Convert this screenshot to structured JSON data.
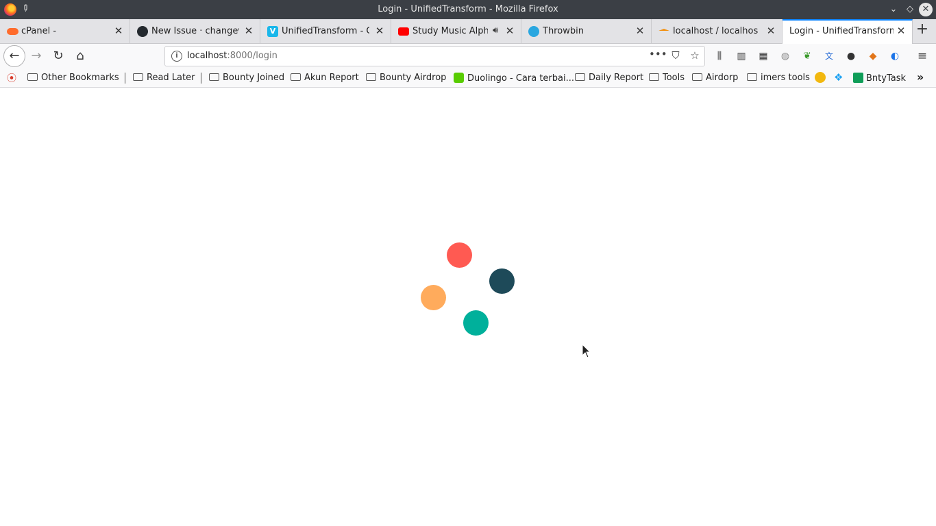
{
  "window": {
    "title": "Login - UnifiedTransform - Mozilla Firefox"
  },
  "tabs": [
    {
      "label": "cPanel -",
      "icon": "cpanel-icon",
      "color": "#ff6c2c"
    },
    {
      "label": "New Issue · changew",
      "icon": "github-icon",
      "color": "#24292e"
    },
    {
      "label": "UnifiedTransform - G",
      "icon": "vimeo-icon",
      "color": "#1ab7ea"
    },
    {
      "label": "Study Music Alpha",
      "icon": "youtube-icon",
      "color": "#ff0000"
    },
    {
      "label": "Throwbin",
      "icon": "throwbin-icon",
      "color": "#2aa7e0"
    },
    {
      "label": "localhost / localhost /",
      "icon": "phpmyadmin-icon",
      "color": "#f29111"
    },
    {
      "label": "Login - UnifiedTransform",
      "icon": "none",
      "active": true
    }
  ],
  "nav": {
    "url_host": "localhost",
    "url_path": ":8000/login"
  },
  "bookmarks": [
    {
      "label": "Other Bookmarks",
      "type": "folder"
    },
    {
      "label": "Read Later",
      "type": "folder"
    },
    {
      "label": "Bounty Joined",
      "type": "folder"
    },
    {
      "label": "Akun Report",
      "type": "folder"
    },
    {
      "label": "Bounty Airdrop",
      "type": "folder"
    },
    {
      "label": "Duolingo - Cara terbai...",
      "type": "link",
      "icon": "duolingo-icon"
    },
    {
      "label": "Daily Report",
      "type": "folder"
    },
    {
      "label": "Tools",
      "type": "folder"
    },
    {
      "label": "Airdorp",
      "type": "folder"
    },
    {
      "label": "imers tools",
      "type": "folder"
    },
    {
      "label": "BntyTask",
      "type": "link",
      "icon": "bntytask-icon"
    }
  ],
  "loader": {
    "colors": [
      "#ff5a52",
      "#1e4a59",
      "#ffab5c",
      "#00b09b"
    ]
  }
}
